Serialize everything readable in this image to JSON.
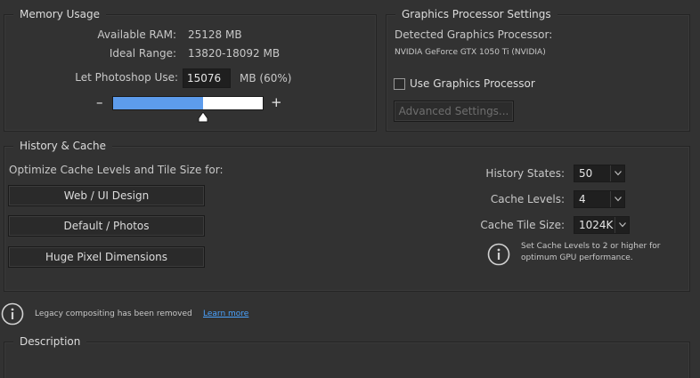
{
  "memory": {
    "title": "Memory Usage",
    "available_label": "Available RAM:",
    "available_value": "25128 MB",
    "ideal_label": "Ideal Range:",
    "ideal_value": "13820-18092 MB",
    "let_label": "Let Photoshop Use:",
    "let_value": "15076",
    "let_suffix": "MB (60%)",
    "minus": "–",
    "plus": "+",
    "slider_fraction": 0.6,
    "fill_color": "#5d9cec"
  },
  "gpu": {
    "title": "Graphics Processor Settings",
    "detected_label": "Detected Graphics Processor:",
    "detected_value": "NVIDIA GeForce GTX 1050 Ti (NVIDIA)",
    "use_gpu_label": "Use Graphics Processor",
    "use_gpu_checked": false,
    "advanced_label": "Advanced Settings..."
  },
  "history": {
    "title": "History & Cache",
    "optimize_label": "Optimize Cache Levels and Tile Size for:",
    "preset_buttons": [
      "Web / UI Design",
      "Default / Photos",
      "Huge Pixel Dimensions"
    ],
    "history_states_label": "History States:",
    "history_states_value": "50",
    "cache_levels_label": "Cache Levels:",
    "cache_levels_value": "4",
    "cache_tile_label": "Cache Tile Size:",
    "cache_tile_value": "1024K",
    "tip_line1": "Set Cache Levels to 2 or higher for",
    "tip_line2": "optimum GPU performance."
  },
  "legacy": {
    "message": "Legacy compositing has been removed",
    "link": "Learn more"
  },
  "description": {
    "title": "Description"
  },
  "icons": {
    "info": "info-icon",
    "caret": "chevron-down-icon"
  }
}
